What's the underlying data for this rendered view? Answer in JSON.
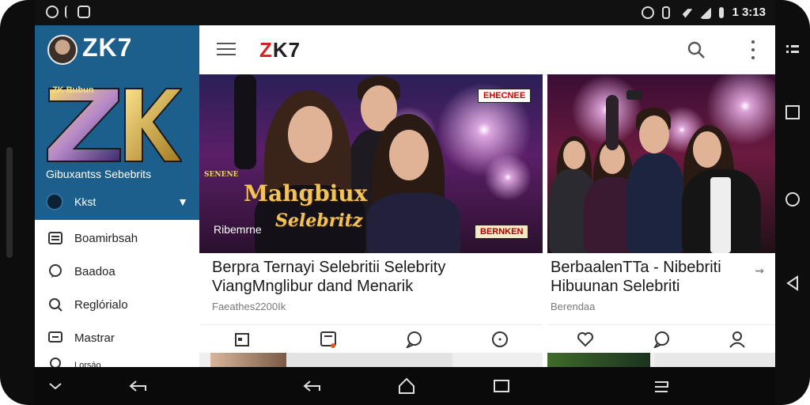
{
  "status_bar": {
    "time": "1 3:13",
    "left_icons": [
      "notification-icon",
      "download-icon",
      "image-icon"
    ],
    "right_icons": [
      "alarm-icon",
      "vibrate-icon",
      "wifi-icon",
      "signal-icon",
      "battery-icon"
    ]
  },
  "drawer": {
    "brand": "ZK7",
    "logo_small_text": "ZK Bubun",
    "logo_letters": "ZK",
    "tagline": "Gibuxantss Sebebrits",
    "account_label": "Kkst",
    "menu": [
      {
        "icon": "list-icon",
        "label": "Boamirbsah"
      },
      {
        "icon": "chat-icon",
        "label": "Baadoa"
      },
      {
        "icon": "search-icon",
        "label": "Reglórialo"
      },
      {
        "icon": "message-icon",
        "label": "Mastrar"
      },
      {
        "icon": "settings-icon",
        "label": "Lorsáo"
      }
    ]
  },
  "appbar": {
    "title_red": "Z",
    "title_rest": "K7"
  },
  "cards": [
    {
      "badge": "EHECNEE",
      "overlay_title": "Mahgbiux",
      "overlay_small": "SENENE",
      "overlay_sub": "Selebritz",
      "caption": "Ribemrne",
      "badge2": "BERNKEN",
      "title_line1": "Berpra Ternayi Selebritii Selebrity",
      "title_line2": "ViangMnglibur dand Menarik",
      "meta": "Faeathes2200Ik",
      "actions": [
        "calendar-icon",
        "bookmark-icon",
        "comment-icon",
        "info-icon"
      ]
    },
    {
      "title_line1": "BerbaalenTTa - Nibebriti",
      "title_line2": "Hibuunan Selebriti",
      "meta": "Berendaa",
      "share_icon": "share-icon",
      "actions": [
        "heart-icon",
        "comment-icon",
        "profile-icon"
      ]
    }
  ],
  "nav": {
    "side": [
      "menu-icon",
      "overview-icon",
      "home-icon",
      "back-icon"
    ],
    "bottom": [
      "chevron-down-icon",
      "back-icon",
      "back-icon",
      "home-icon",
      "overview-icon",
      "menu-icon"
    ]
  }
}
